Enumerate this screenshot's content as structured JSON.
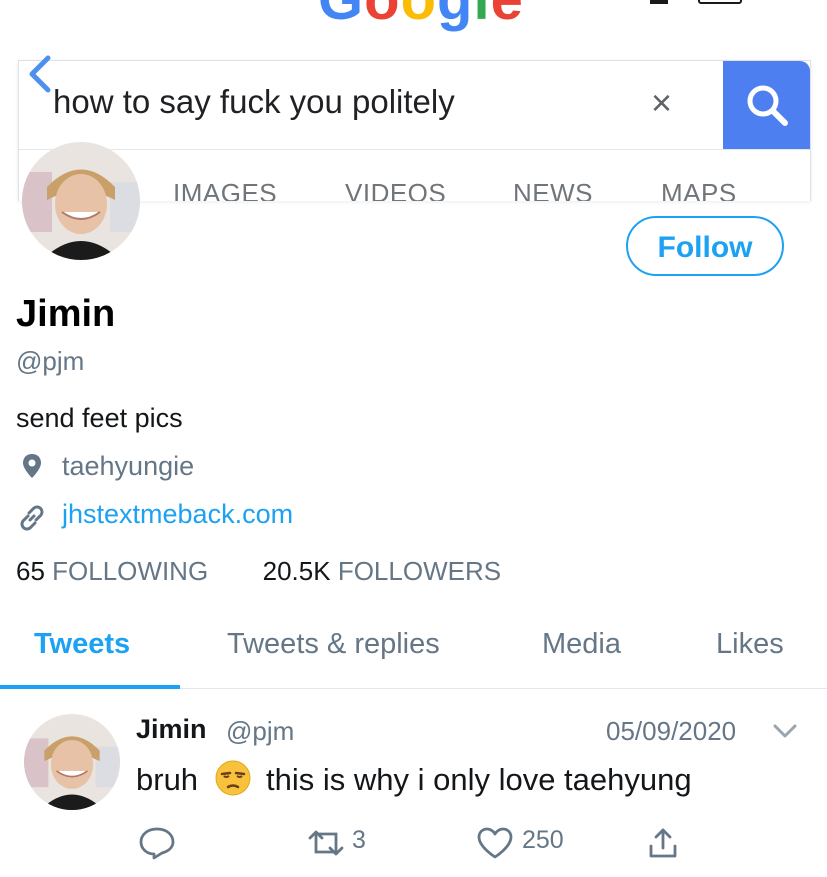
{
  "google": {
    "logo_letters": [
      "G",
      "o",
      "o",
      "g",
      "l",
      "e"
    ],
    "search_query": "how to say fuck you politely",
    "clear_icon": "×",
    "tabs": [
      "IMAGES",
      "VIDEOS",
      "NEWS",
      "MAPS"
    ],
    "accent_color": "#4e7ff0"
  },
  "profile": {
    "display_name": "Jimin",
    "handle": "@pjm",
    "bio": "send feet pics",
    "location": "taehyungie",
    "website": "jhstextmeback.com",
    "following_count": "65",
    "following_label": "FOLLOWING",
    "followers_count": "20.5K",
    "followers_label": "FOLLOWERS",
    "follow_button": "Follow",
    "accent_color": "#1da1f2"
  },
  "profile_tabs": [
    "Tweets",
    "Tweets & replies",
    "Media",
    "Likes"
  ],
  "active_tab": "Tweets",
  "tweet": {
    "name": "Jimin",
    "handle": "@pjm",
    "date": "05/09/2020",
    "text_before_emoji": "bruh",
    "emoji": "unamused-face",
    "text_after_emoji": "this is why i only love taehyung",
    "reply_count": "",
    "retweet_count": "3",
    "like_count": "250"
  },
  "icons": [
    "back-chevron-icon",
    "close-icon",
    "search-icon",
    "location-pin-icon",
    "link-icon",
    "chevron-down-icon",
    "reply-icon",
    "retweet-icon",
    "like-icon",
    "share-icon",
    "unamused-face-emoji"
  ]
}
